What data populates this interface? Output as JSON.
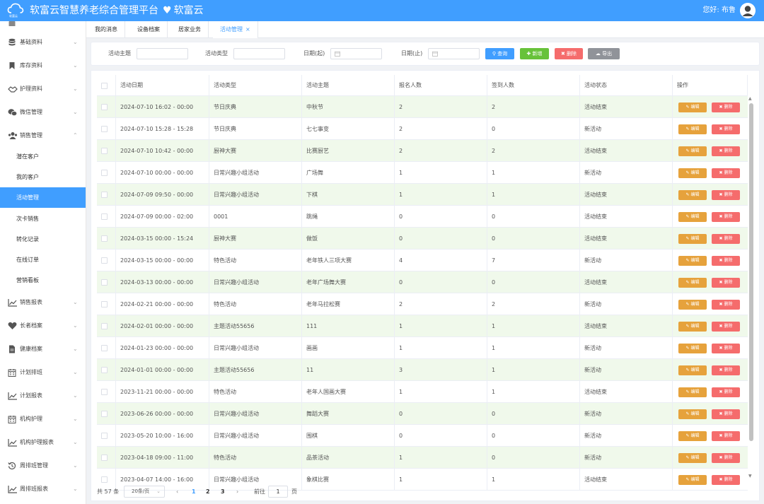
{
  "app": {
    "logo_text": "软富云",
    "title": "软富云智慧养老综合管理平台",
    "brand": "软富云",
    "greeting": "您好: 布鲁",
    "accent_color": "#409eff"
  },
  "sidebar": {
    "groups": [
      {
        "label": "基础资料",
        "icon": "database-icon"
      },
      {
        "label": "库存资料",
        "icon": "bookmark-icon"
      },
      {
        "label": "护理资料",
        "icon": "handshake-icon"
      },
      {
        "label": "微信管理",
        "icon": "wechat-icon"
      },
      {
        "label": "销售管理",
        "icon": "users-icon"
      }
    ],
    "sub_items": [
      {
        "label": "潜在客户"
      },
      {
        "label": "我的客户"
      },
      {
        "label": "活动管理",
        "active": true
      },
      {
        "label": "次卡销售"
      },
      {
        "label": "转化记录"
      },
      {
        "label": "在线订单"
      },
      {
        "label": "营销看板"
      }
    ],
    "groups_after": [
      {
        "label": "销售报表",
        "icon": "line-chart-icon"
      },
      {
        "label": "长者档案",
        "icon": "heart-icon"
      },
      {
        "label": "健康档案",
        "icon": "file-icon"
      },
      {
        "label": "计划排班",
        "icon": "calendar-icon"
      },
      {
        "label": "计划报表",
        "icon": "line-chart-icon"
      },
      {
        "label": "机构护理",
        "icon": "calendar-icon"
      },
      {
        "label": "机构护理报表",
        "icon": "line-chart-icon"
      },
      {
        "label": "周排班管理",
        "icon": "history-icon"
      },
      {
        "label": "周排班报表",
        "icon": "line-chart-icon"
      }
    ]
  },
  "tabs": [
    {
      "label": "我的消息"
    },
    {
      "label": "设备档案"
    },
    {
      "label": "居家业务"
    },
    {
      "label": "活动管理",
      "active": true,
      "close": "×"
    }
  ],
  "filter": {
    "topic_label": "活动主题",
    "type_label": "活动类型",
    "date_start_label": "日期(起)",
    "date_end_label": "日期(止)",
    "query": "查询",
    "add": "新增",
    "delete": "删除",
    "export": "导出"
  },
  "table": {
    "headers": [
      "活动日期",
      "活动类型",
      "活动主题",
      "报名人数",
      "签到人数",
      "活动状态",
      "操作"
    ],
    "edit_label": "编辑",
    "delete_label": "删除",
    "rows": [
      {
        "date": "2024-07-10 16:02 - 00:00",
        "type": "节日庆典",
        "topic": "中秋节",
        "signup": "2",
        "checkin": "2",
        "status": "活动结束"
      },
      {
        "date": "2024-07-10 15:28 - 15:28",
        "type": "节日庆典",
        "topic": "七七事变",
        "signup": "2",
        "checkin": "0",
        "status": "新活动"
      },
      {
        "date": "2024-07-10 10:42 - 00:00",
        "type": "厨神大赛",
        "topic": "比赛厨艺",
        "signup": "2",
        "checkin": "2",
        "status": "活动结束"
      },
      {
        "date": "2024-07-10 00:00 - 00:00",
        "type": "日常兴趣小组活动",
        "topic": "广场舞",
        "signup": "1",
        "checkin": "1",
        "status": "新活动"
      },
      {
        "date": "2024-07-09 09:50 - 00:00",
        "type": "日常兴趣小组活动",
        "topic": "下棋",
        "signup": "1",
        "checkin": "1",
        "status": "活动结束"
      },
      {
        "date": "2024-07-09 00:00 - 02:00",
        "type": "0001",
        "topic": "跳绳",
        "signup": "0",
        "checkin": "0",
        "status": "活动结束"
      },
      {
        "date": "2024-03-15 00:00 - 15:24",
        "type": "厨神大赛",
        "topic": "做饭",
        "signup": "0",
        "checkin": "0",
        "status": "活动结束"
      },
      {
        "date": "2024-03-15 00:00 - 00:00",
        "type": "特色活动",
        "topic": "老年铁人三项大赛",
        "signup": "4",
        "checkin": "7",
        "status": "新活动"
      },
      {
        "date": "2024-03-13 00:00 - 00:00",
        "type": "日常兴趣小组活动",
        "topic": "老年广场舞大赛",
        "signup": "0",
        "checkin": "0",
        "status": "活动结束"
      },
      {
        "date": "2024-02-21 00:00 - 00:00",
        "type": "特色活动",
        "topic": "老年马拉松赛",
        "signup": "2",
        "checkin": "2",
        "status": "新活动"
      },
      {
        "date": "2024-02-01 00:00 - 00:00",
        "type": "主题活动55656",
        "topic": "111",
        "signup": "1",
        "checkin": "1",
        "status": "活动结束"
      },
      {
        "date": "2024-01-23 00:00 - 00:00",
        "type": "日常兴趣小组活动",
        "topic": "画画",
        "signup": "1",
        "checkin": "1",
        "status": "新活动"
      },
      {
        "date": "2024-01-01 00:00 - 00:00",
        "type": "主题活动55656",
        "topic": "11",
        "signup": "3",
        "checkin": "1",
        "status": "新活动"
      },
      {
        "date": "2023-11-21 00:00 - 00:00",
        "type": "特色活动",
        "topic": "老年人国画大赛",
        "signup": "1",
        "checkin": "1",
        "status": "活动结束"
      },
      {
        "date": "2023-06-26 00:00 - 00:00",
        "type": "日常兴趣小组活动",
        "topic": "舞蹈大赛",
        "signup": "0",
        "checkin": "0",
        "status": "新活动"
      },
      {
        "date": "2023-05-20 10:00 - 16:00",
        "type": "日常兴趣小组活动",
        "topic": "围棋",
        "signup": "0",
        "checkin": "0",
        "status": "新活动"
      },
      {
        "date": "2023-04-18 09:00 - 11:00",
        "type": "特色活动",
        "topic": "品茶活动",
        "signup": "1",
        "checkin": "0",
        "status": "新活动"
      },
      {
        "date": "2023-04-07 14:00 - 16:00",
        "type": "日常兴趣小组活动",
        "topic": "象棋比赛",
        "signup": "1",
        "checkin": "1",
        "status": "活动结束"
      }
    ]
  },
  "pagination": {
    "total": "共 57 条",
    "page_size": "20条/页",
    "prev": "‹",
    "next": "›",
    "pages": [
      "1",
      "2",
      "3"
    ],
    "goto_label": "前往",
    "goto_value": "1",
    "page_label": "页"
  }
}
